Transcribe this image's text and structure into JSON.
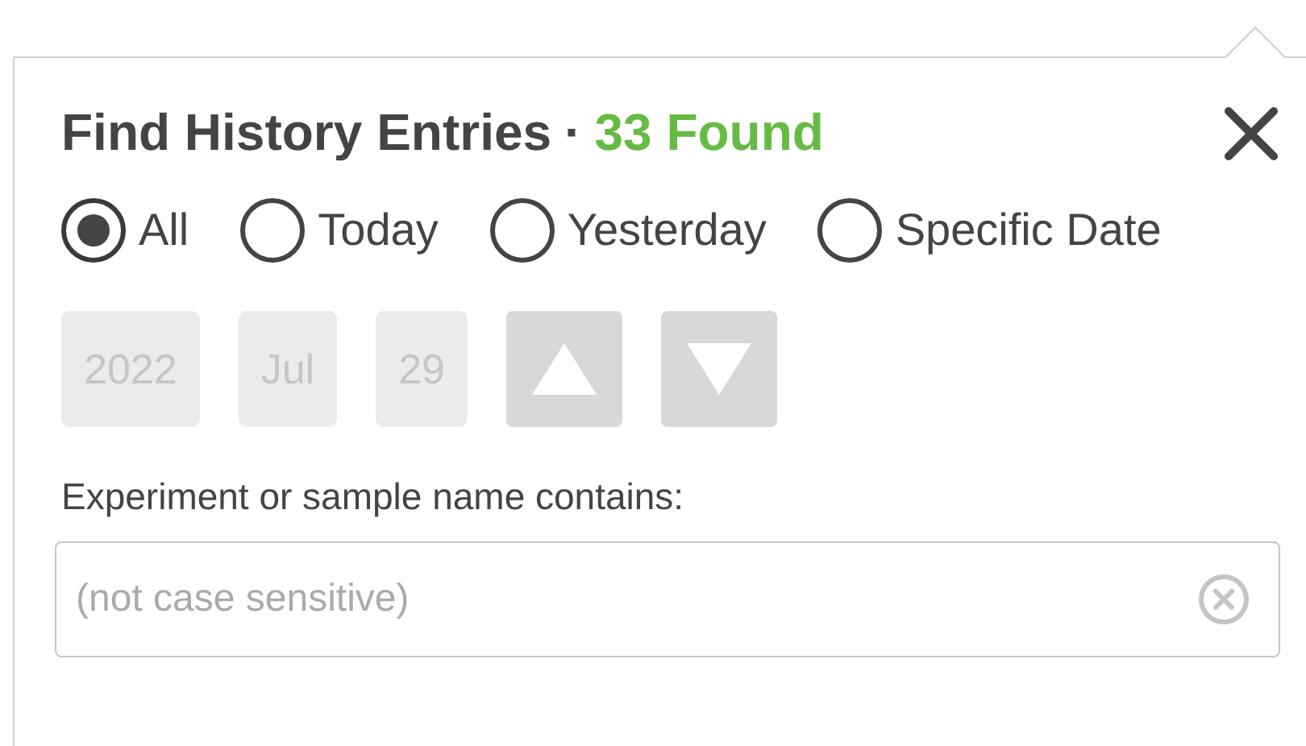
{
  "header": {
    "title": "Find History Entries",
    "separator": "·",
    "count": "33 Found"
  },
  "date_filter": {
    "options": [
      {
        "label": "All",
        "selected": true
      },
      {
        "label": "Today",
        "selected": false
      },
      {
        "label": "Yesterday",
        "selected": false
      },
      {
        "label": "Specific Date",
        "selected": false
      }
    ]
  },
  "date_picker": {
    "disabled": true,
    "year": "2022",
    "month": "Jul",
    "day": "29"
  },
  "name_filter": {
    "label": "Experiment or sample name contains:",
    "placeholder": "(not case sensitive)"
  }
}
